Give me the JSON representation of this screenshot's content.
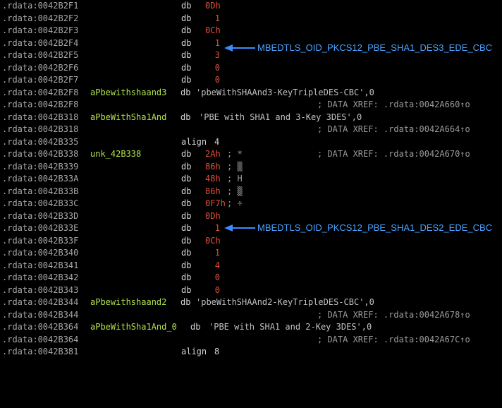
{
  "rows": [
    {
      "addr": ".rdata:0042B2F1",
      "label": "",
      "mnem": "db",
      "val": "0Dh",
      "cmt": ""
    },
    {
      "addr": ".rdata:0042B2F2",
      "label": "",
      "mnem": "db",
      "val": "1",
      "cmt": ""
    },
    {
      "addr": ".rdata:0042B2F3",
      "label": "",
      "mnem": "db",
      "val": "0Ch",
      "cmt": ""
    },
    {
      "addr": ".rdata:0042B2F4",
      "label": "",
      "mnem": "db",
      "val": "1",
      "cmt": ""
    },
    {
      "addr": ".rdata:0042B2F5",
      "label": "",
      "mnem": "db",
      "val": "3",
      "cmt": ""
    },
    {
      "addr": ".rdata:0042B2F6",
      "label": "",
      "mnem": "db",
      "val": "0",
      "cmt": ""
    },
    {
      "addr": ".rdata:0042B2F7",
      "label": "",
      "mnem": "db",
      "val": "0",
      "cmt": ""
    },
    {
      "addr": ".rdata:0042B2F8",
      "label": "aPbewithshaand3",
      "mnem": "db",
      "str": "'pbeWithSHAAnd3-KeyTripleDES-CBC'",
      "tail": ",0"
    },
    {
      "addr": ".rdata:0042B2F8",
      "xref": "; DATA XREF: .rdata:0042A660↑o"
    },
    {
      "addr": ".rdata:0042B318",
      "label": "aPbeWithSha1And",
      "mnem": "db",
      "str": "'PBE with SHA1 and 3-Key 3DES'",
      "tail": ",0"
    },
    {
      "addr": ".rdata:0042B318",
      "xref": "; DATA XREF: .rdata:0042A664↑o"
    },
    {
      "addr": ".rdata:0042B335",
      "mnem": "align",
      "val": "4"
    },
    {
      "addr": ".rdata:0042B338",
      "label": "unk_42B338",
      "mnem": "db",
      "val": "2Ah",
      "cmt": "; *",
      "xref": "; DATA XREF: .rdata:0042A670↑o"
    },
    {
      "addr": ".rdata:0042B339",
      "mnem": "db",
      "val": "86h",
      "cmt": "; ▒"
    },
    {
      "addr": ".rdata:0042B33A",
      "mnem": "db",
      "val": "48h",
      "cmt": "; H"
    },
    {
      "addr": ".rdata:0042B33B",
      "mnem": "db",
      "val": "86h",
      "cmt": "; ▒"
    },
    {
      "addr": ".rdata:0042B33C",
      "mnem": "db",
      "val": "0F7h",
      "cmt": "; ÷"
    },
    {
      "addr": ".rdata:0042B33D",
      "mnem": "db",
      "val": "0Dh"
    },
    {
      "addr": ".rdata:0042B33E",
      "mnem": "db",
      "val": "1"
    },
    {
      "addr": ".rdata:0042B33F",
      "mnem": "db",
      "val": "0Ch"
    },
    {
      "addr": ".rdata:0042B340",
      "mnem": "db",
      "val": "1"
    },
    {
      "addr": ".rdata:0042B341",
      "mnem": "db",
      "val": "4"
    },
    {
      "addr": ".rdata:0042B342",
      "mnem": "db",
      "val": "0"
    },
    {
      "addr": ".rdata:0042B343",
      "mnem": "db",
      "val": "0"
    },
    {
      "addr": ".rdata:0042B344",
      "label": "aPbewithshaand2",
      "mnem": "db",
      "str": "'pbeWithSHAAnd2-KeyTripleDES-CBC'",
      "tail": ",0"
    },
    {
      "addr": ".rdata:0042B344",
      "xref": "; DATA XREF: .rdata:0042A678↑o"
    },
    {
      "addr": ".rdata:0042B364",
      "label": "aPbeWithSha1And_0",
      "mnem": "db",
      "str": "'PBE with SHA1 and 2-Key 3DES'",
      "tail": ",0"
    },
    {
      "addr": ".rdata:0042B364",
      "xref": "; DATA XREF: .rdata:0042A67C↑o"
    },
    {
      "addr": ".rdata:0042B381",
      "mnem": "align",
      "val": "8"
    }
  ],
  "annotations": {
    "a1": {
      "text": "MBEDTLS_OID_PKCS12_PBE_SHA1_DES3_EDE_CBC",
      "color": "#4aa3ff"
    },
    "a2": {
      "text": "MBEDTLS_OID_PKCS12_PBE_SHA1_DES2_EDE_CBC",
      "color": "#4aa3ff"
    }
  },
  "colors": {
    "background": "#000000",
    "address": "#a8a8a8",
    "label": "#b0e04c",
    "number": "#e0503a",
    "arrow": "#3c8cff"
  }
}
